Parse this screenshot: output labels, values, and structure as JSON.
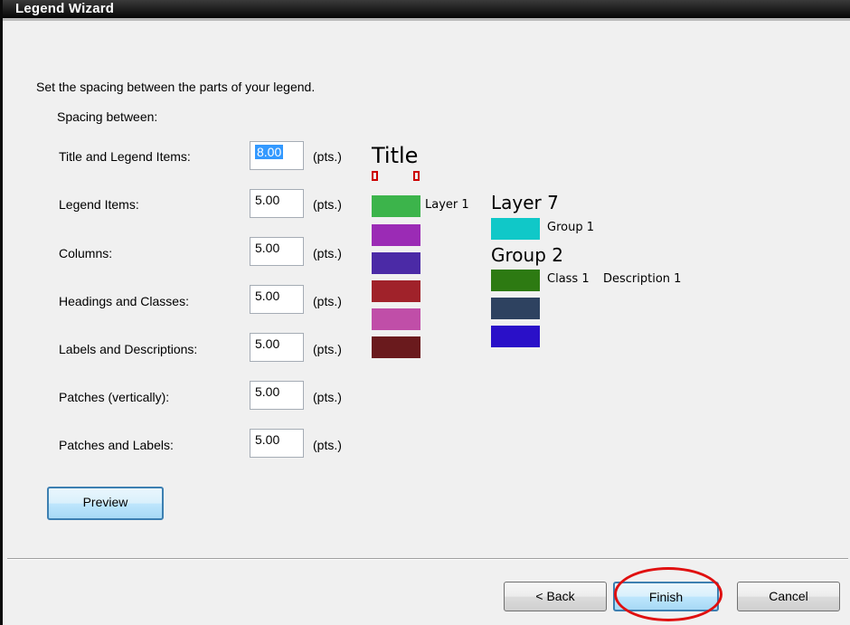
{
  "window": {
    "title": "Legend Wizard"
  },
  "instructions": "Set the spacing between the parts of your legend.",
  "section_label": "Spacing between:",
  "units": "(pts.)",
  "fields": [
    {
      "label": "Title and Legend Items:",
      "value": "8.00"
    },
    {
      "label": "Legend Items:",
      "value": "5.00"
    },
    {
      "label": "Columns:",
      "value": "5.00"
    },
    {
      "label": "Headings and Classes:",
      "value": "5.00"
    },
    {
      "label": "Labels and Descriptions:",
      "value": "5.00"
    },
    {
      "label": "Patches (vertically):",
      "value": "5.00"
    },
    {
      "label": "Patches and Labels:",
      "value": "5.00"
    }
  ],
  "buttons": {
    "preview": "Preview",
    "back": "< Back",
    "finish": "Finish",
    "cancel": "Cancel"
  },
  "preview": {
    "title": "Title",
    "layer1": "Layer 1",
    "layer7": "Layer 7",
    "group1": "Group 1",
    "group2": "Group 2",
    "class1": "Class 1",
    "description1": "Description 1",
    "colors": {
      "col1": [
        "#3cb44b",
        "#9b2bb5",
        "#4b2aa6",
        "#a0222a",
        "#c04ea8",
        "#6a1a1d"
      ],
      "group1": "#10c8c8",
      "col2": [
        "#2d7a12",
        "#2e4260",
        "#2a10c8"
      ]
    }
  },
  "annotation_color": "#e01010"
}
